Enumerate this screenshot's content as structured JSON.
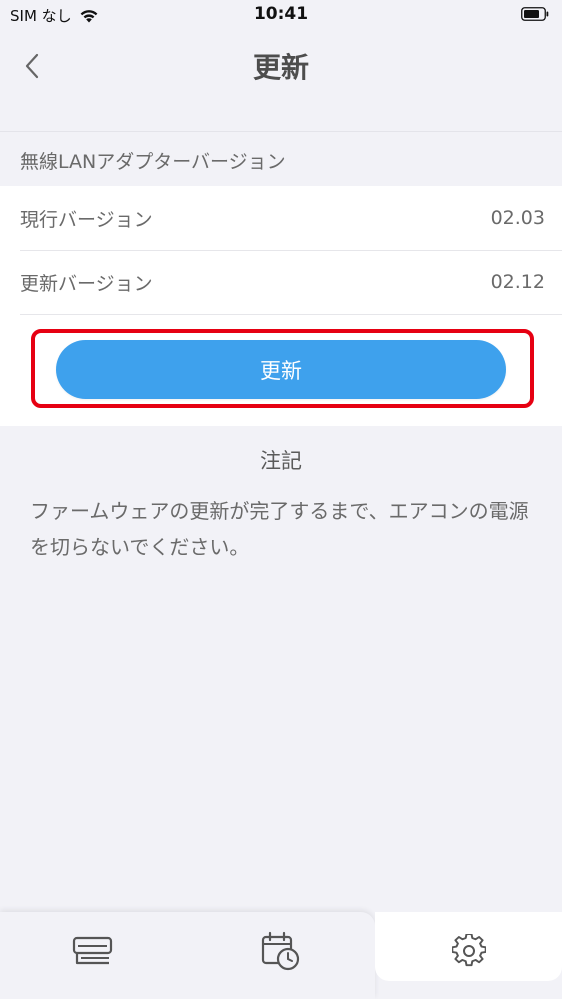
{
  "status_bar": {
    "carrier": "SIM なし",
    "time": "10:41"
  },
  "nav": {
    "title": "更新",
    "back_icon": "chevron-left-icon"
  },
  "section": {
    "header": "無線LANアダプターバージョン"
  },
  "rows": [
    {
      "label": "現行バージョン",
      "value": "02.03"
    },
    {
      "label": "更新バージョン",
      "value": "02.12"
    }
  ],
  "update_button": {
    "label": "更新"
  },
  "note": {
    "title": "注記",
    "body": "ファームウェアの更新が完了するまで、エアコンの電源を切らないでください。"
  },
  "tab_bar": {
    "items": [
      {
        "icon": "aircon-icon",
        "selected": false
      },
      {
        "icon": "calendar-clock-icon",
        "selected": false
      },
      {
        "icon": "gear-icon",
        "selected": true
      }
    ]
  },
  "colors": {
    "accent": "#3ea1ed",
    "highlight": "#e60012",
    "background": "#f2f2f7"
  }
}
